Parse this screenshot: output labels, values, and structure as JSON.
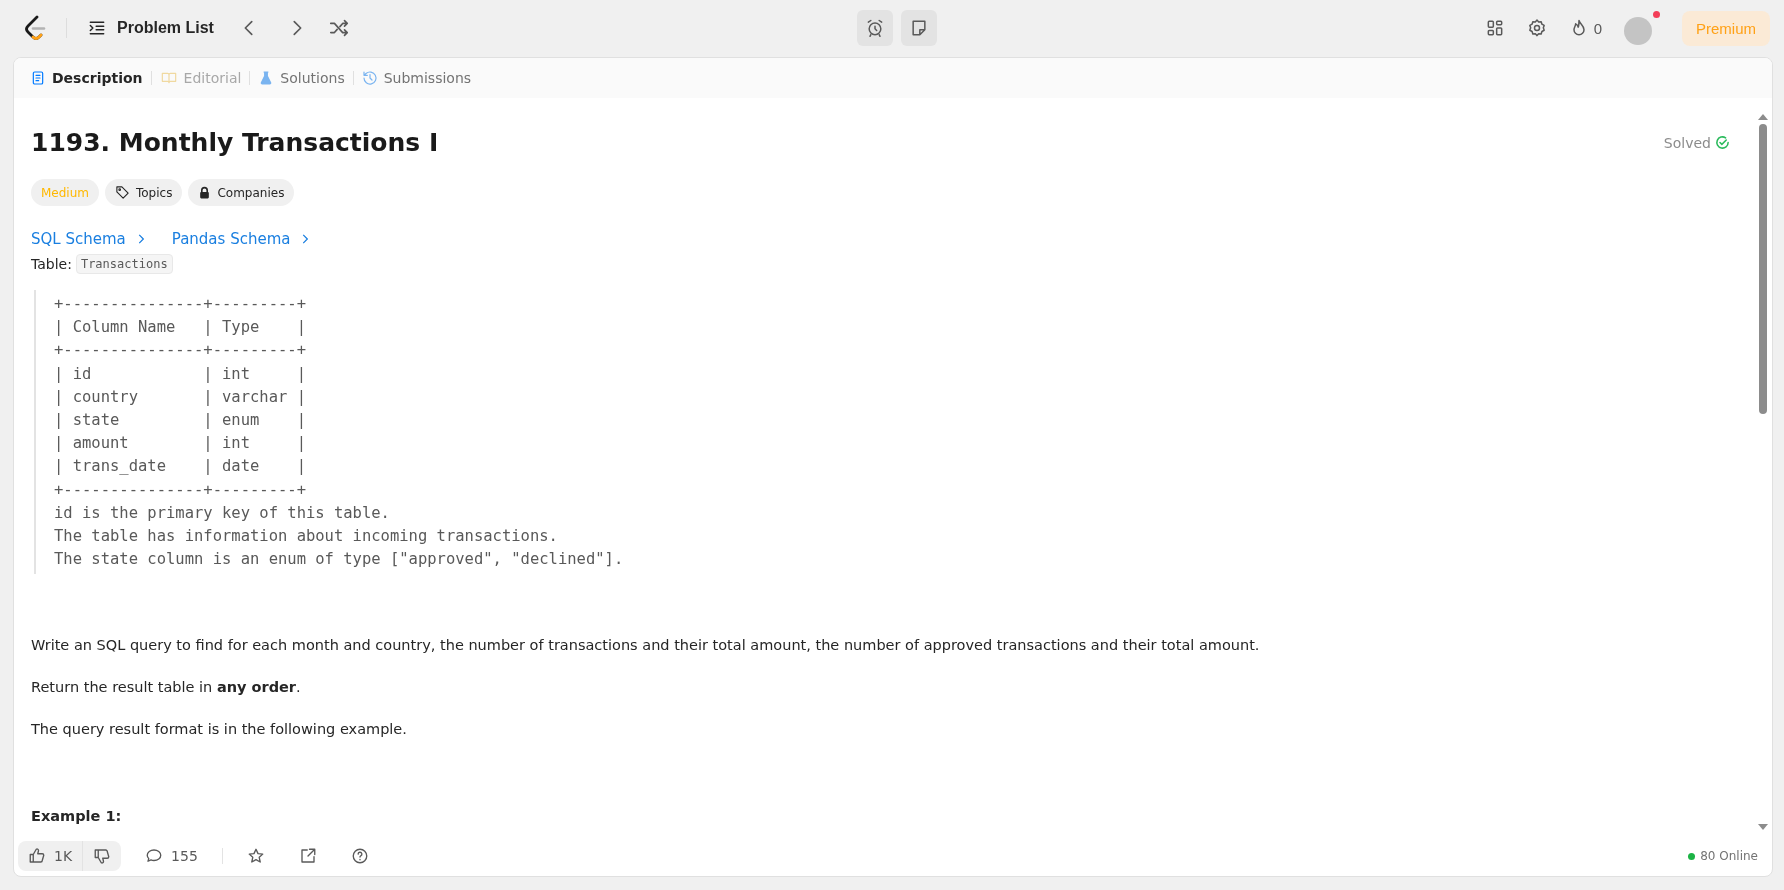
{
  "topbar": {
    "problem_list": "Problem List",
    "streak": "0",
    "premium": "Premium",
    "notification": true
  },
  "tabs": [
    {
      "label": "Description",
      "selected": true,
      "disabled": false
    },
    {
      "label": "Editorial",
      "selected": false,
      "disabled": true
    },
    {
      "label": "Solutions",
      "selected": false,
      "disabled": false
    },
    {
      "label": "Submissions",
      "selected": false,
      "disabled": false
    }
  ],
  "problem": {
    "title": "1193. Monthly Transactions I",
    "status": "Solved",
    "tags": [
      {
        "label": "Medium",
        "kind": "difficulty"
      },
      {
        "label": "Topics",
        "kind": "tag"
      },
      {
        "label": "Companies",
        "kind": "lock"
      }
    ],
    "schema_links": [
      "SQL Schema",
      "Pandas Schema"
    ],
    "table_label": "Table:",
    "table_name": "Transactions",
    "schema": "+---------------+---------+\n| Column Name   | Type    |\n+---------------+---------+\n| id            | int     |\n| country       | varchar |\n| state         | enum    |\n| amount        | int     |\n| trans_date    | date    |\n+---------------+---------+\nid is the primary key of this table.\nThe table has information about incoming transactions.\nThe state column is an enum of type [\"approved\", \"declined\"].",
    "paragraphs": [
      "Write an SQL query to find for each month and country, the number of transactions and their total amount, the number of approved transactions and their total amount.",
      "Return the result table in **any order**.",
      "The query result format is in the following example."
    ],
    "example_heading": "Example 1:"
  },
  "footer": {
    "likes": "1K",
    "comments": "155",
    "online": "80 Online"
  }
}
